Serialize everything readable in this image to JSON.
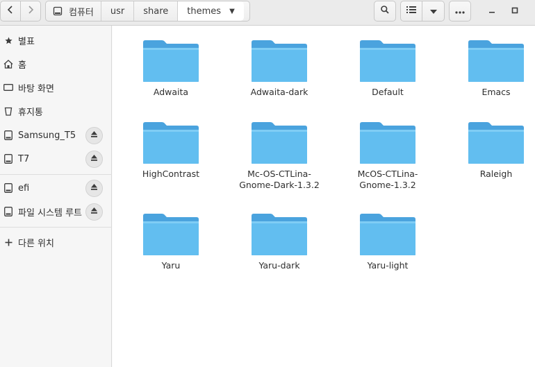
{
  "nav": {
    "back_icon": "chevron-left-icon",
    "forward_icon": "chevron-right-icon"
  },
  "pathbar": {
    "home_label": "컴퓨터",
    "crumbs": [
      "usr",
      "share",
      "themes"
    ]
  },
  "toolbar": {
    "search_icon": "search-icon",
    "view_icon": "list-view-icon",
    "view_dropdown_icon": "chevron-down-icon",
    "menu_icon": "more-options-icon"
  },
  "window": {
    "minimize_icon": "minimize-icon",
    "maximize_icon": "maximize-icon"
  },
  "sidebar": {
    "items": [
      {
        "label": "별표",
        "icon": "star-icon"
      },
      {
        "label": "홈",
        "icon": "home-icon"
      },
      {
        "label": "바탕 화면",
        "icon": "desktop-icon"
      },
      {
        "label": "휴지통",
        "icon": "trash-icon"
      },
      {
        "label": "Samsung_T5",
        "icon": "drive-icon",
        "ejectable": true
      },
      {
        "label": "T7",
        "icon": "drive-icon",
        "ejectable": true
      },
      {
        "label": "efi",
        "icon": "drive-icon",
        "ejectable": true
      },
      {
        "label": "파일 시스템 루트",
        "icon": "drive-icon",
        "ejectable": true
      },
      {
        "label": "다른 위치",
        "icon": "plus-icon"
      }
    ]
  },
  "folders": [
    "Adwaita",
    "Adwaita-dark",
    "Default",
    "Emacs",
    "HighContrast",
    "Mc-OS-CTLina-\nGnome-Dark-1.3.2",
    "McOS-CTLina-\nGnome-1.3.2",
    "Raleigh",
    "Yaru",
    "Yaru-dark",
    "Yaru-light"
  ],
  "colors": {
    "folder_body": "#5ab7ec",
    "folder_tab": "#4aa3de",
    "folder_front": "#6cc3f2"
  }
}
